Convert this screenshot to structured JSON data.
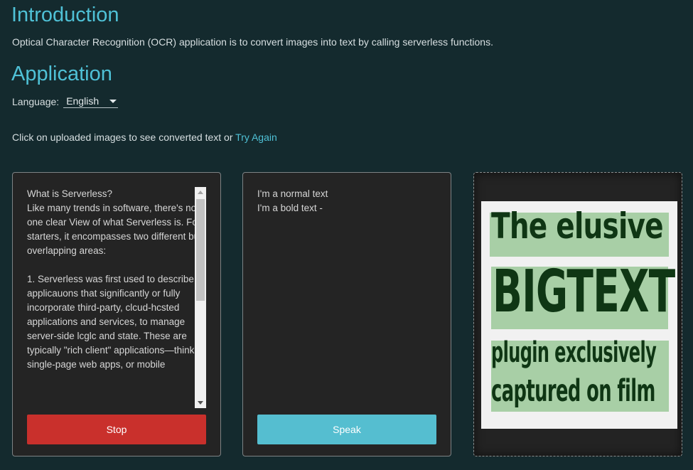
{
  "intro": {
    "title": "Introduction",
    "description": "Optical Character Recognition (OCR) application is to convert images into text by calling serverless functions."
  },
  "application": {
    "title": "Application",
    "language_label": "Language:",
    "language_value": "English",
    "hint_text": "Click on uploaded images to see converted text or ",
    "try_again_link": "Try Again"
  },
  "cards": [
    {
      "text": "What is Serverless?\nLike many trends in software, there's no one clear View of what Serverless is. For\nstarters, it encompasses two different but overlapping areas:\n\n1. Serverless was first used to describe applicauons that significantly or fully\nincorporate third-party, clcud-hcsted applications and services, to manage\nserver-side lcglc and state. These are typically \"rich client\" applications—think\nsingle-page web apps, or mobile",
      "button_label": "Stop"
    },
    {
      "text": "I'm a normal text\nI'm a bold text -",
      "button_label": "Speak"
    }
  ],
  "image": {
    "lines": [
      "The elusive",
      "BIGTEXT",
      "plugin exclusively",
      "captured on film"
    ]
  },
  "colors": {
    "background": "#142a2e",
    "heading": "#4fc1d6",
    "stop": "#c9302c",
    "speak": "#55bed0",
    "highlight": "#a8cfa6"
  }
}
